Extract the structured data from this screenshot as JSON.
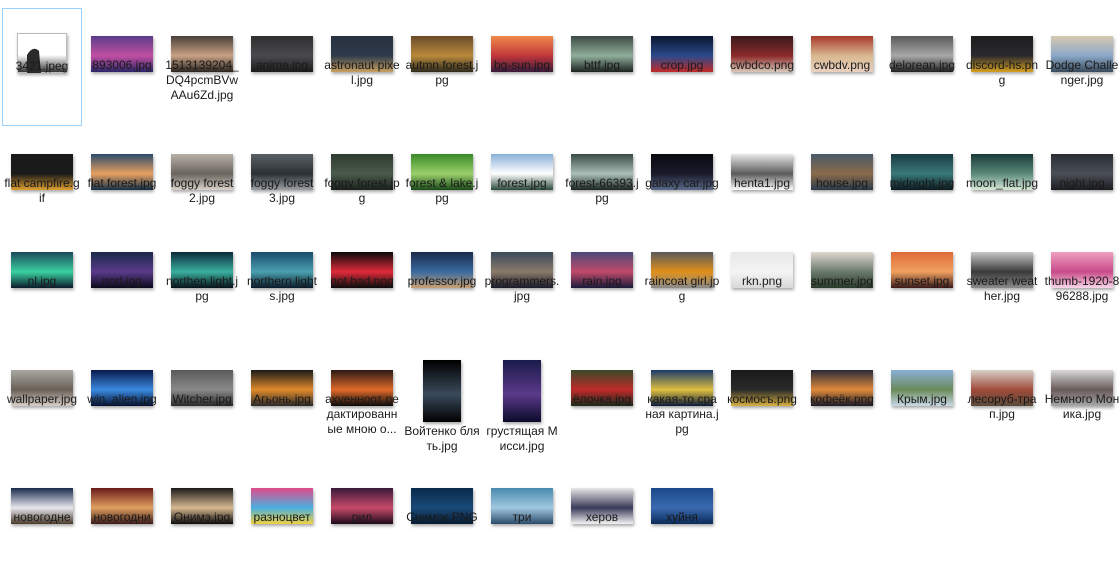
{
  "files": [
    {
      "name": "3421.jpeg",
      "colors": [
        "#ffffff",
        "#ffffff",
        "#2a2a2a"
      ],
      "shape": "doc"
    },
    {
      "name": "893006.jpg",
      "colors": [
        "#5a3d8a",
        "#c24fa3",
        "#2b2466"
      ]
    },
    {
      "name": "1513139204_DQ4pcmBVwAAu6Zd.jpg",
      "colors": [
        "#4a4038",
        "#c9a184",
        "#2a2420"
      ]
    },
    {
      "name": "anime.jpg",
      "colors": [
        "#2e2e30",
        "#4a4a4e",
        "#1b1b1c"
      ]
    },
    {
      "name": "astronaut pixel.jpg",
      "colors": [
        "#27313e",
        "#2f3b4b",
        "#c8a060"
      ]
    },
    {
      "name": "autmn forest.jpg",
      "colors": [
        "#6a4a2a",
        "#b98a3b",
        "#2f2a1c"
      ]
    },
    {
      "name": "bg-sun.jpg",
      "colors": [
        "#f08a4a",
        "#c0363a",
        "#3a1a3a"
      ]
    },
    {
      "name": "bttf.jpg",
      "colors": [
        "#3c4a44",
        "#8fae9a",
        "#1d2420"
      ]
    },
    {
      "name": "crop.jpg",
      "colors": [
        "#0b1630",
        "#2a4a8a",
        "#c02a2a"
      ]
    },
    {
      "name": "cwbdco.png",
      "colors": [
        "#3a1a1a",
        "#8a2a2a",
        "#d8c8b8"
      ]
    },
    {
      "name": "cwbdv.png",
      "colors": [
        "#a83a2a",
        "#d8b890",
        "#e8d0c0"
      ]
    },
    {
      "name": "delorean.jpg",
      "colors": [
        "#5a5a5a",
        "#a8a8a8",
        "#222222"
      ]
    },
    {
      "name": "discord-hs.png",
      "colors": [
        "#1e1e20",
        "#2a2a2e",
        "#d8a020"
      ]
    },
    {
      "name": "Dodge Challenger.jpg",
      "colors": [
        "#d8c8b0",
        "#8aa8c8",
        "#3a4a5a"
      ]
    },
    {
      "name": "flat campfire.gif",
      "colors": [
        "#1a1a1a",
        "#1a1a1a",
        "#e0a030"
      ]
    },
    {
      "name": "flat forest.jpg",
      "colors": [
        "#2a4a6a",
        "#e8a060",
        "#12304a"
      ]
    },
    {
      "name": "foggy forest 2.jpg",
      "colors": [
        "#b8b0a8",
        "#6a645e",
        "#d8d2ca"
      ]
    },
    {
      "name": "foggy forest 3.jpg",
      "colors": [
        "#5a6064",
        "#2a3034",
        "#9aa0a4"
      ]
    },
    {
      "name": "foggy forest.jpg",
      "colors": [
        "#2e3a30",
        "#4a5a4a",
        "#1a221c"
      ]
    },
    {
      "name": "forest & lake.jpg",
      "colors": [
        "#3a8a2a",
        "#9ad06a",
        "#1a4a1a"
      ]
    },
    {
      "name": "forest.jpg",
      "colors": [
        "#8ab0d8",
        "#ffffff",
        "#2a4a3a"
      ]
    },
    {
      "name": "forest-66393.jpg",
      "colors": [
        "#3a4a44",
        "#aac0b8",
        "#1a2420"
      ]
    },
    {
      "name": "galaxy car.jpg",
      "colors": [
        "#0a0a12",
        "#1a1a2a",
        "#5a6a8a"
      ]
    },
    {
      "name": "henta1.jpg",
      "colors": [
        "#e8e8e8",
        "#5a5a5a",
        "#ffffff"
      ]
    },
    {
      "name": "house.jpg",
      "colors": [
        "#4a5a6a",
        "#8a6a4a",
        "#2a3a4a"
      ]
    },
    {
      "name": "midnight.jpg",
      "colors": [
        "#1a3a44",
        "#3a7a7a",
        "#0a1a20"
      ]
    },
    {
      "name": "moon_flat.jpg",
      "colors": [
        "#1a3a3a",
        "#5a8a7a",
        "#d8e8d8"
      ]
    },
    {
      "name": "night.jpg",
      "colors": [
        "#2a2e34",
        "#4a4e56",
        "#1a1c20"
      ]
    },
    {
      "name": "nl.jpg",
      "colors": [
        "#1a4a5a",
        "#3ad0a0",
        "#0a1a2a"
      ]
    },
    {
      "name": "norl.jpg",
      "colors": [
        "#1a2a4a",
        "#5a3a8a",
        "#0a0a1a"
      ]
    },
    {
      "name": "northen light.jpg",
      "colors": [
        "#0a2a3a",
        "#3ab0a0",
        "#061018"
      ]
    },
    {
      "name": "northern lights.jpg",
      "colors": [
        "#1a4a6a",
        "#4aa0b0",
        "#0a1a2a"
      ]
    },
    {
      "name": "not bad.png",
      "colors": [
        "#0a0a0a",
        "#e02a3a",
        "#0a0a0a"
      ]
    },
    {
      "name": "professor.jpg",
      "colors": [
        "#1a2a4a",
        "#3a6aa0",
        "#c8a070"
      ]
    },
    {
      "name": "programmers.jpg",
      "colors": [
        "#3a4a5a",
        "#8a7a6a",
        "#1a1a2a"
      ]
    },
    {
      "name": "rain.jpg",
      "colors": [
        "#4a4a7a",
        "#c04a6a",
        "#1a1a3a"
      ]
    },
    {
      "name": "raincoat girl.jpg",
      "colors": [
        "#5a5a5a",
        "#e0901a",
        "#8a8a8a"
      ]
    },
    {
      "name": "rkn.png",
      "colors": [
        "#e8e8e8",
        "#f4f4f4",
        "#d8d8d8"
      ]
    },
    {
      "name": "summer.jpg",
      "colors": [
        "#e0d8d0",
        "#6a7a6a",
        "#2a3a2a"
      ]
    },
    {
      "name": "sunset.jpg",
      "colors": [
        "#e06a3a",
        "#f0a060",
        "#3a1a1a"
      ]
    },
    {
      "name": "sweater weather.jpg",
      "colors": [
        "#c8c8c8",
        "#3a3a3a",
        "#8a8a8a"
      ]
    },
    {
      "name": "thumb-1920-896288.jpg",
      "colors": [
        "#f0a0c0",
        "#c84a8a",
        "#f8d8e8"
      ]
    },
    {
      "name": "wallpaper.jpg",
      "colors": [
        "#a8a8a0",
        "#6a6058",
        "#d8d0c8"
      ]
    },
    {
      "name": "win_alien.jpg",
      "colors": [
        "#0a1a4a",
        "#3a8ae0",
        "#061030"
      ]
    },
    {
      "name": "Witcher.jpg",
      "colors": [
        "#5a5a5a",
        "#8a8a8a",
        "#2a2a2a"
      ]
    },
    {
      "name": "Агьонь.jpg",
      "colors": [
        "#1a1a1a",
        "#e08a2a",
        "#2a2a2a"
      ]
    },
    {
      "name": "ахуенноот редактированные мною о...",
      "colors": [
        "#2a1a14",
        "#e06a2a",
        "#0a0a0a"
      ]
    },
    {
      "name": "Войтенко блять.jpg",
      "colors": [
        "#000000",
        "#3a4a5a",
        "#000000"
      ],
      "shape": "portrait-bar"
    },
    {
      "name": "грустящая Мисси.jpg",
      "colors": [
        "#1a1a4a",
        "#5a3a8a",
        "#0a0a2a"
      ],
      "shape": "portrait"
    },
    {
      "name": "ёлочка.jpg",
      "colors": [
        "#3a4a2a",
        "#c02a2a",
        "#1a2a1a"
      ]
    },
    {
      "name": "какая-то сраная картина.jpg",
      "colors": [
        "#1a3a6a",
        "#e0c040",
        "#0a1a3a"
      ]
    },
    {
      "name": "космосъ.png",
      "colors": [
        "#1a1a1a",
        "#2a2a2a",
        "#d8b040"
      ]
    },
    {
      "name": "кофеёк.png",
      "colors": [
        "#2a2a3a",
        "#e08a3a",
        "#1a1a2a"
      ]
    },
    {
      "name": "Крым.jpg",
      "colors": [
        "#8ab0d8",
        "#6a8a5a",
        "#c8d8e8"
      ]
    },
    {
      "name": "лесоруб-трап.jpg",
      "colors": [
        "#d8d0c8",
        "#a04a3a",
        "#5a4a3a"
      ]
    },
    {
      "name": "Немного Моника.jpg",
      "colors": [
        "#d8d8d8",
        "#6a5a5a",
        "#a8a8a8"
      ]
    },
    {
      "name": "новогодне",
      "colors": [
        "#1a2a4a",
        "#e8e8f0",
        "#4a3a2a"
      ]
    },
    {
      "name": "новогодни",
      "colors": [
        "#6a1a1a",
        "#e0a060",
        "#3a1a1a"
      ]
    },
    {
      "name": "Онимэ.jpg",
      "colors": [
        "#1a1a1a",
        "#d8b890",
        "#0a0a0a"
      ]
    },
    {
      "name": "разноцвет",
      "colors": [
        "#e04a8a",
        "#4ab0e0",
        "#f0d040"
      ]
    },
    {
      "name": "рил",
      "colors": [
        "#3a1a3a",
        "#c84a6a",
        "#1a0a1a"
      ]
    },
    {
      "name": "Снимок.PNG",
      "colors": [
        "#0a2a4a",
        "#1a4a7a",
        "#061a30"
      ]
    },
    {
      "name": "три",
      "colors": [
        "#4a8ab0",
        "#a0c8e0",
        "#2a4a6a"
      ]
    },
    {
      "name": "херов",
      "colors": [
        "#e8e8e8",
        "#3a3a5a",
        "#f4f4f4"
      ]
    },
    {
      "name": "хуйня",
      "colors": [
        "#1a4a8a",
        "#3a6ab0",
        "#0a2a5a"
      ]
    }
  ]
}
